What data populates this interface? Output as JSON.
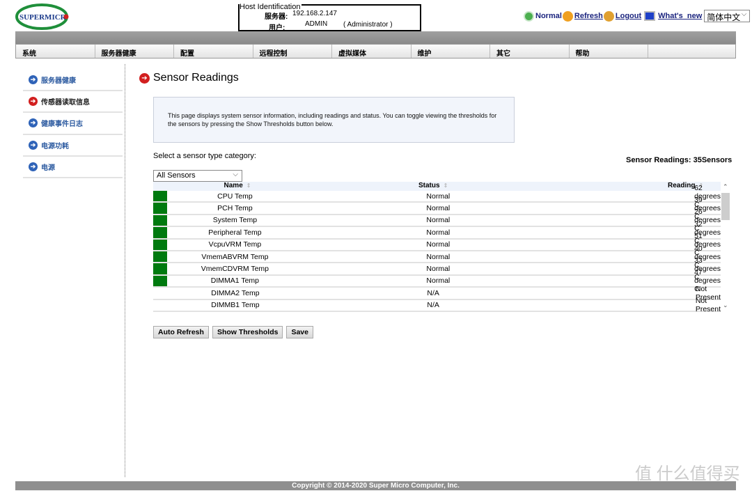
{
  "logo": {
    "text": "SUPERMICRO"
  },
  "host": {
    "legend": "Host Identification",
    "server_label": "服务器:",
    "server": "192.168.2.147",
    "user_label": "用户:",
    "user": "ADMIN",
    "role": "( Administrator )"
  },
  "topbar": {
    "status": "Normal",
    "refresh": "Refresh",
    "logout": "Logout",
    "whats_new": "What's_new",
    "language": "简体中文"
  },
  "nav": [
    "系统",
    "服务器健康",
    "配置",
    "远程控制",
    "虚拟媒体",
    "维护",
    "其它",
    "帮助",
    ""
  ],
  "sidebar": [
    {
      "label": "服务器健康"
    },
    {
      "label": "传感器读取信息",
      "active": true
    },
    {
      "label": "健康事件日志"
    },
    {
      "label": "电源功耗"
    },
    {
      "label": "电源"
    }
  ],
  "page": {
    "title": "Sensor Readings",
    "info": "This page displays system sensor information, including readings and status. You can toggle viewing the thresholds for the sensors by pressing the Show Thresholds button below.",
    "select_label": "Select a sensor type category:",
    "select_value": "All Sensors",
    "count": "Sensor Readings: 35Sensors"
  },
  "table": {
    "headers": [
      "Name",
      "Status",
      "Reading"
    ],
    "rows": [
      {
        "name": "CPU Temp",
        "status": "Normal",
        "reading": "62 degrees C",
        "ok": true
      },
      {
        "name": "PCH Temp",
        "status": "Normal",
        "reading": "39 degrees C",
        "ok": true
      },
      {
        "name": "System Temp",
        "status": "Normal",
        "reading": "26 degrees C",
        "ok": true
      },
      {
        "name": "Peripheral Temp",
        "status": "Normal",
        "reading": "32 degrees C",
        "ok": true
      },
      {
        "name": "VcpuVRM Temp",
        "status": "Normal",
        "reading": "51 degrees C",
        "ok": true
      },
      {
        "name": "VmemABVRM Temp",
        "status": "Normal",
        "reading": "40 degrees C",
        "ok": true
      },
      {
        "name": "VmemCDVRM Temp",
        "status": "Normal",
        "reading": "33 degrees C",
        "ok": true
      },
      {
        "name": "DIMMA1 Temp",
        "status": "Normal",
        "reading": "47 degrees C",
        "ok": true
      },
      {
        "name": "DIMMA2 Temp",
        "status": "N/A",
        "reading": "Not Present",
        "ok": false
      },
      {
        "name": "DIMMB1 Temp",
        "status": "N/A",
        "reading": "Not Present",
        "ok": false
      }
    ]
  },
  "buttons": {
    "auto_refresh": "Auto Refresh",
    "show_thresholds": "Show Thresholds",
    "save": "Save"
  },
  "footer": "Copyright © 2014-2020 Super Micro Computer, Inc.",
  "watermark": "值 什么值得买",
  "colors": {
    "ok": "#007a0f",
    "accent_link": "#1a237e",
    "sidebar_arrow": "#2f63b8",
    "active_arrow": "#d21f1f"
  }
}
